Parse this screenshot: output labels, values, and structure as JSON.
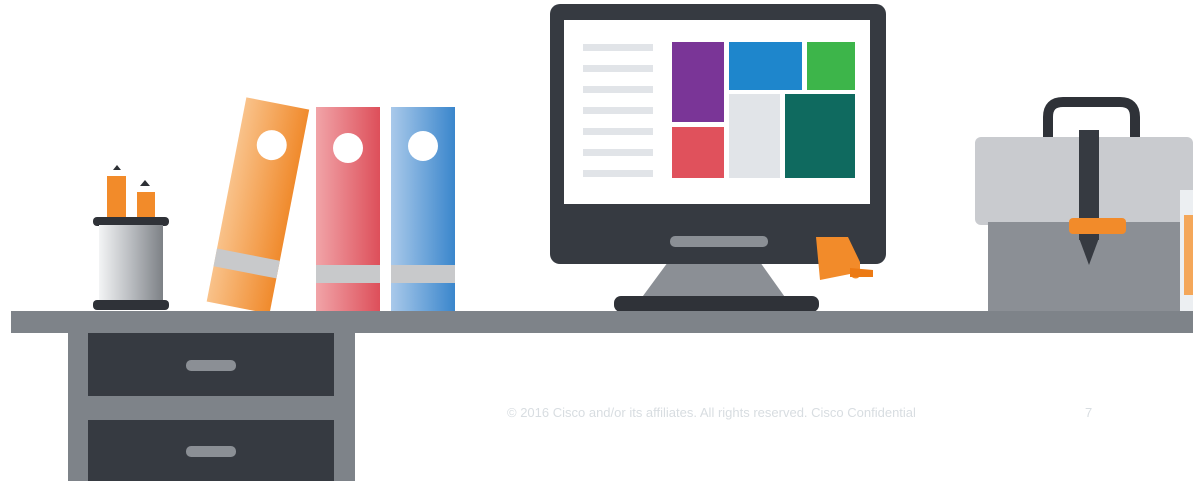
{
  "slide": {
    "footer_text": "© 2016  Cisco and/or its affiliates. All rights reserved.   Cisco Confidential",
    "page_number": "7"
  },
  "illustration": {
    "scene": "office desk",
    "icons": [
      "pencil-cup-icon",
      "binder-icon",
      "monitor-icon",
      "briefcase-icon",
      "desk-drawer-icon"
    ]
  },
  "colors": {
    "desk_top": "#7e8389",
    "drawer": "#363a41",
    "orange": "#f28b2a",
    "red": "#e0515c",
    "blue": "#3e8fd0",
    "purple": "#7a3597",
    "green": "#3db54a",
    "teal": "#0f6a5f",
    "light_gray": "#e1e4e8"
  }
}
